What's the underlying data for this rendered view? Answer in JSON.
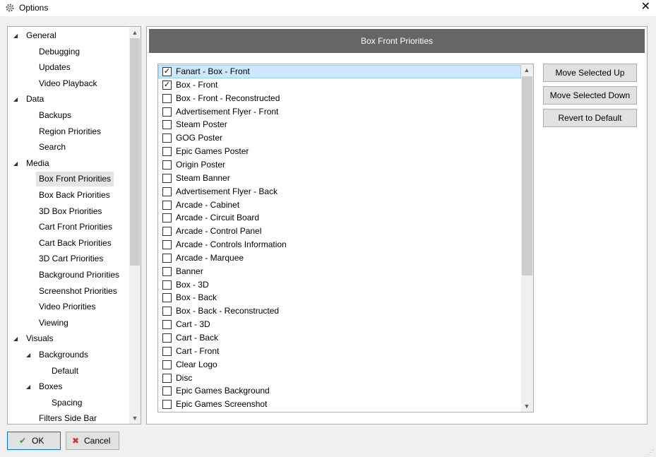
{
  "window": {
    "title": "Options",
    "close_glyph": "✕"
  },
  "tree": {
    "items": [
      {
        "label": "General",
        "level": 0,
        "expanded": true
      },
      {
        "label": "Debugging",
        "level": 1
      },
      {
        "label": "Updates",
        "level": 1
      },
      {
        "label": "Video Playback",
        "level": 1
      },
      {
        "label": "Data",
        "level": 0,
        "expanded": true
      },
      {
        "label": "Backups",
        "level": 1
      },
      {
        "label": "Region Priorities",
        "level": 1
      },
      {
        "label": "Search",
        "level": 1
      },
      {
        "label": "Media",
        "level": 0,
        "expanded": true
      },
      {
        "label": "Box Front Priorities",
        "level": 1,
        "selected": true
      },
      {
        "label": "Box Back Priorities",
        "level": 1
      },
      {
        "label": "3D Box Priorities",
        "level": 1
      },
      {
        "label": "Cart Front Priorities",
        "level": 1
      },
      {
        "label": "Cart Back Priorities",
        "level": 1
      },
      {
        "label": "3D Cart Priorities",
        "level": 1
      },
      {
        "label": "Background Priorities",
        "level": 1
      },
      {
        "label": "Screenshot Priorities",
        "level": 1
      },
      {
        "label": "Video Priorities",
        "level": 1
      },
      {
        "label": "Viewing",
        "level": 1
      },
      {
        "label": "Visuals",
        "level": 0,
        "expanded": true
      },
      {
        "label": "Backgrounds",
        "level": 1,
        "expanded": true
      },
      {
        "label": "Default",
        "level": 2
      },
      {
        "label": "Boxes",
        "level": 1,
        "expanded": true
      },
      {
        "label": "Spacing",
        "level": 2
      },
      {
        "label": "Filters Side Bar",
        "level": 1
      }
    ]
  },
  "panel": {
    "title": "Box Front Priorities",
    "list": [
      {
        "label": "Fanart - Box - Front",
        "checked": true,
        "selected": true
      },
      {
        "label": "Box - Front",
        "checked": true
      },
      {
        "label": "Box - Front - Reconstructed",
        "checked": false
      },
      {
        "label": "Advertisement Flyer - Front",
        "checked": false
      },
      {
        "label": "Steam Poster",
        "checked": false
      },
      {
        "label": "GOG Poster",
        "checked": false
      },
      {
        "label": "Epic Games Poster",
        "checked": false
      },
      {
        "label": "Origin Poster",
        "checked": false
      },
      {
        "label": "Steam Banner",
        "checked": false
      },
      {
        "label": "Advertisement Flyer - Back",
        "checked": false
      },
      {
        "label": "Arcade - Cabinet",
        "checked": false
      },
      {
        "label": "Arcade - Circuit Board",
        "checked": false
      },
      {
        "label": "Arcade - Control Panel",
        "checked": false
      },
      {
        "label": "Arcade - Controls Information",
        "checked": false
      },
      {
        "label": "Arcade - Marquee",
        "checked": false
      },
      {
        "label": "Banner",
        "checked": false
      },
      {
        "label": "Box - 3D",
        "checked": false
      },
      {
        "label": "Box - Back",
        "checked": false
      },
      {
        "label": "Box - Back - Reconstructed",
        "checked": false
      },
      {
        "label": "Cart - 3D",
        "checked": false
      },
      {
        "label": "Cart - Back",
        "checked": false
      },
      {
        "label": "Cart - Front",
        "checked": false
      },
      {
        "label": "Clear Logo",
        "checked": false
      },
      {
        "label": "Disc",
        "checked": false
      },
      {
        "label": "Epic Games Background",
        "checked": false
      },
      {
        "label": "Epic Games Screenshot",
        "checked": false
      }
    ],
    "buttons": {
      "move_up": "Move Selected Up",
      "move_down": "Move Selected Down",
      "revert": "Revert to Default"
    }
  },
  "footer": {
    "ok_label": "OK",
    "cancel_label": "Cancel",
    "ok_icon": "checkmark-icon",
    "cancel_icon": "x-icon",
    "ok_icon_color": "#2e9a2e",
    "cancel_icon_color": "#d32f2f"
  },
  "colors": {
    "header_bg": "#666666",
    "selection_bg": "#cce8ff",
    "selection_border": "#99d1ff"
  }
}
